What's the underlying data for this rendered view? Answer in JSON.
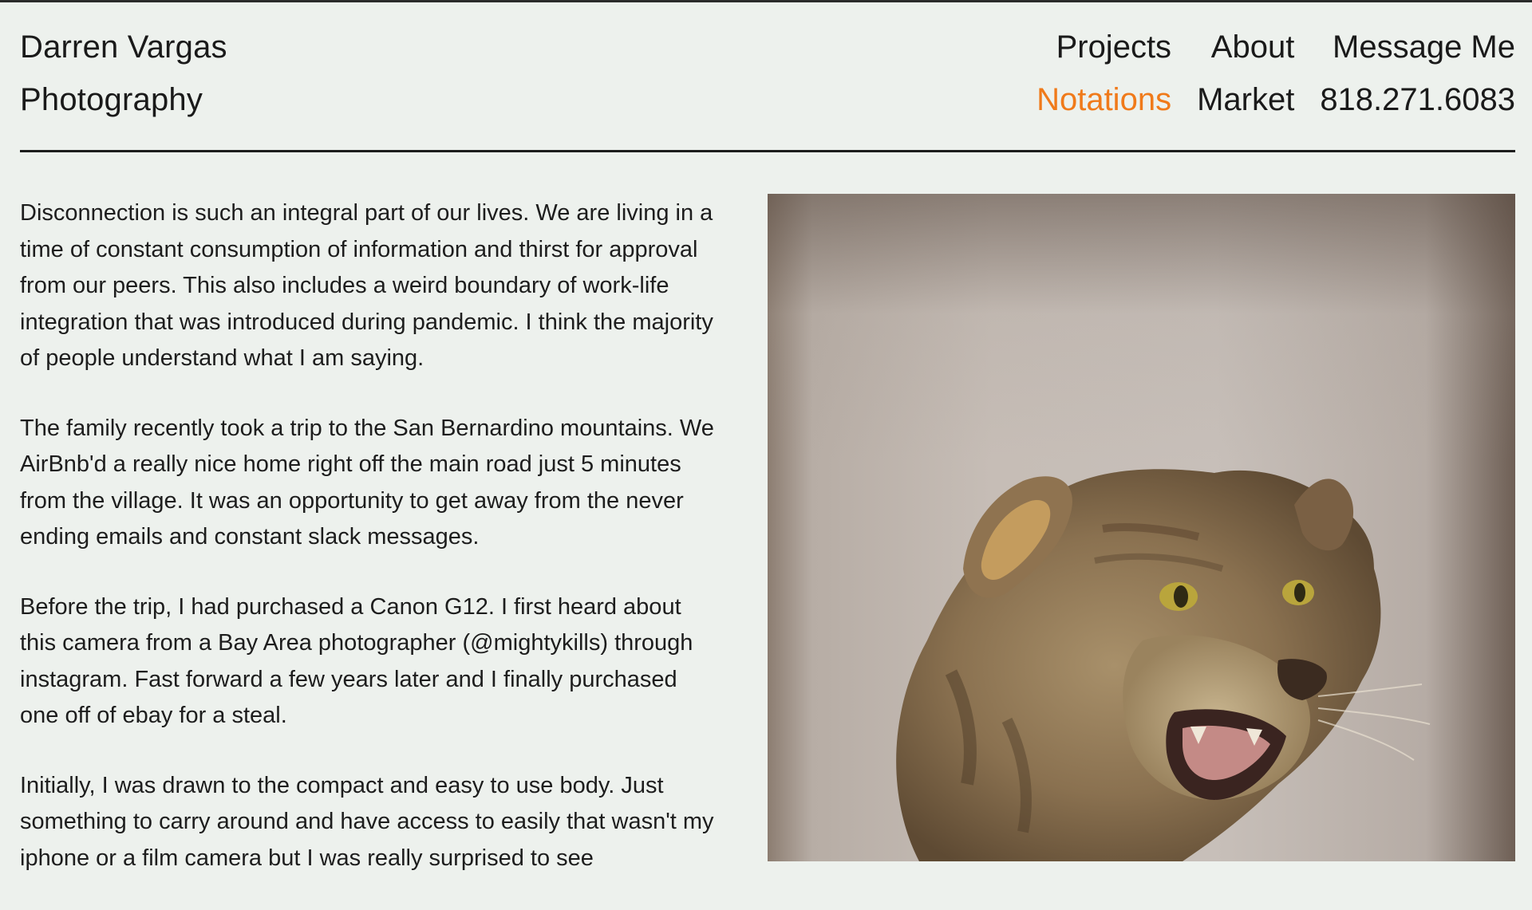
{
  "brand": {
    "line1": "Darren Vargas",
    "line2": "Photography"
  },
  "nav": {
    "projects": "Projects",
    "about": "About",
    "message": "Message Me",
    "notations": "Notations",
    "market": "Market",
    "phone": "818.271.6083",
    "active": "Notations",
    "accent_color": "#f07a1a"
  },
  "article": {
    "paragraphs": [
      "Disconnection is such an integral part of our lives. We are living in a time of constant consumption of information and thirst for approval from our peers. This also includes a weird boundary of work-life integration that was introduced during pandemic. I think the majority of people understand what I am saying.",
      "The family recently took a trip to the San Bernardino mountains. We AirBnb'd a really nice home right off the main road just 5 minutes from the village. It was an opportunity to get away from the never ending emails and constant slack messages.",
      "Before the trip, I had purchased a Canon G12. I first heard about this camera from a Bay Area photographer (@mightykills) through instagram. Fast forward a few years later and I finally purchased one off of ebay for a steal.",
      "Initially, I was drawn to the compact and easy to use body. Just something to carry around and have access to easily that wasn't my iphone or a film camera but I was really surprised to see"
    ]
  },
  "photo": {
    "subject": "taxidermy-wildcat-head"
  }
}
